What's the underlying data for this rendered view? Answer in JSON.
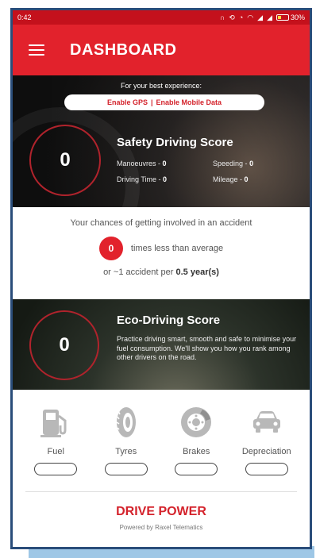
{
  "status_bar": {
    "time": "0:42",
    "battery": "30%",
    "battery_level": 0.3,
    "icons": [
      "headphones-icon",
      "sync-icon",
      "alarm-icon",
      "wifi-icon",
      "signal-icon",
      "signal-icon",
      "battery-icon"
    ]
  },
  "toolbar": {
    "title": "DASHBOARD",
    "menu_icon": "hamburger-menu-icon"
  },
  "safety": {
    "hint": "For your best experience:",
    "enable_gps": "Enable GPS",
    "separator": "|",
    "enable_mobile_data": "Enable Mobile Data",
    "score": "0",
    "title": "Safety Driving Score",
    "manoeuvres_label": "Manoeuvres -",
    "manoeuvres_value": "0",
    "speeding_label": "Speeding -",
    "speeding_value": "0",
    "driving_time_label": "Driving Time -",
    "driving_time_value": "0",
    "mileage_label": "Mileage -",
    "mileage_value": "0"
  },
  "accident": {
    "line1": "Your chances of getting involved in an accident",
    "times_value": "0",
    "times_text": "times less than average",
    "line3_prefix": "or ~1 accident per",
    "line3_value": "0.5 year(s)"
  },
  "eco": {
    "score": "0",
    "title": "Eco-Driving Score",
    "description": "Practice driving smart, smooth and safe to minimise your fuel consumption. We'll show you how you rank among other drivers on the road."
  },
  "categories": [
    {
      "label": "Fuel",
      "icon": "fuel-pump-icon"
    },
    {
      "label": "Tyres",
      "icon": "tyre-icon"
    },
    {
      "label": "Brakes",
      "icon": "brake-disc-icon"
    },
    {
      "label": "Depreciation",
      "icon": "car-icon"
    }
  ],
  "footer": {
    "brand": "DRIVE POWER",
    "powered_by": "Powered by Raxel Telematics"
  },
  "colors": {
    "brand_red": "#e2222c",
    "status_red": "#c4111c",
    "icon_gray": "#b8b8b8",
    "frame_blue": "#2a4d7a"
  }
}
